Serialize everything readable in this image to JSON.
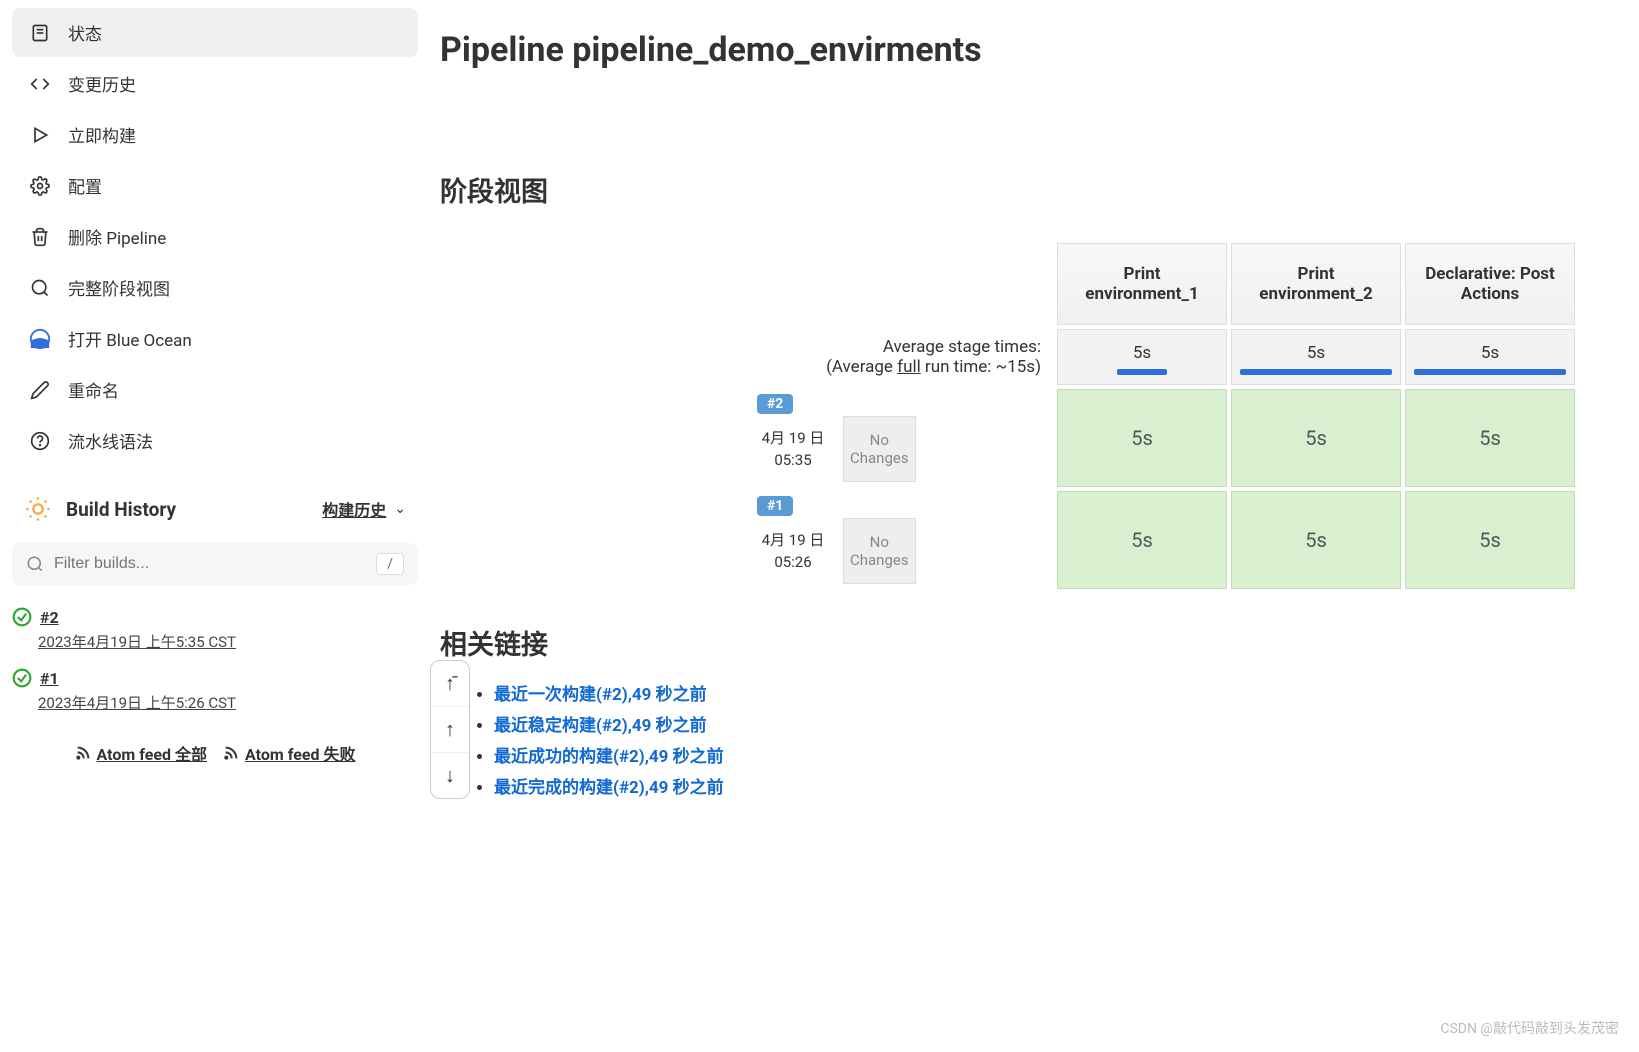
{
  "sidebar": {
    "items": [
      {
        "label": "状态",
        "icon": "status"
      },
      {
        "label": "变更历史",
        "icon": "changes"
      },
      {
        "label": "立即构建",
        "icon": "play"
      },
      {
        "label": "配置",
        "icon": "gear"
      },
      {
        "label": "删除 Pipeline",
        "icon": "trash"
      },
      {
        "label": "完整阶段视图",
        "icon": "search"
      },
      {
        "label": "打开 Blue Ocean",
        "icon": "blueocean"
      },
      {
        "label": "重命名",
        "icon": "edit"
      },
      {
        "label": "流水线语法",
        "icon": "help"
      }
    ]
  },
  "buildHistory": {
    "title": "Build History",
    "subtitle": "构建历史",
    "filterPlaceholder": "Filter builds...",
    "filterKey": "/",
    "builds": [
      {
        "num": "#2",
        "date": "2023年4月19日 上午5:35 CST"
      },
      {
        "num": "#1",
        "date": "2023年4月19日 上午5:26 CST"
      }
    ],
    "feedAll": "Atom feed 全部",
    "feedFail": "Atom feed 失败"
  },
  "main": {
    "title": "Pipeline pipeline_demo_envirments",
    "stageViewTitle": "阶段视图",
    "stageHeaders": [
      "Print environment_1",
      "Print environment_2",
      "Declarative: Post Actions"
    ],
    "avgLabel": "Average stage times:",
    "avgFullLabel_pre": "(Average ",
    "avgFullLabel_full": "full",
    "avgFullLabel_post": " run time: ~15s)",
    "avgTimes": [
      "5s",
      "5s",
      "5s"
    ],
    "stageRuns": [
      {
        "badge": "#2",
        "date": "4月 19 日",
        "time": "05:35",
        "changes": "No Changes",
        "cells": [
          "5s",
          "5s",
          "5s"
        ]
      },
      {
        "badge": "#1",
        "date": "4月 19 日",
        "time": "05:26",
        "changes": "No Changes",
        "cells": [
          "5s",
          "5s",
          "5s"
        ]
      }
    ],
    "relatedTitle": "相关链接",
    "relatedLinks": [
      "最近一次构建(#2),49 秒之前",
      "最近稳定构建(#2),49 秒之前",
      "最近成功的构建(#2),49 秒之前",
      "最近完成的构建(#2),49 秒之前"
    ]
  },
  "watermark": "CSDN @敲代码敲到头发茂密"
}
